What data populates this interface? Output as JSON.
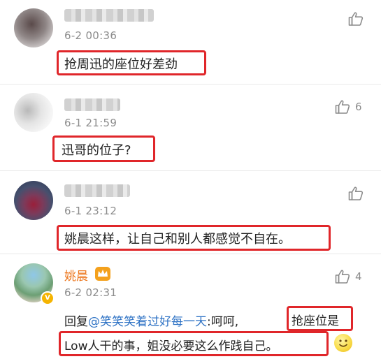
{
  "comments": [
    {
      "time": "6-2 00:36",
      "text": "抢周迅的座位好差劲",
      "likes": ""
    },
    {
      "time": "6-1 21:59",
      "text": "迅哥的位子?",
      "likes": "6"
    },
    {
      "time": "6-1 23:12",
      "text": "姚晨这样，让自己和别人都感觉不自在。",
      "likes": ""
    },
    {
      "name": "姚晨",
      "time": "6-2 02:31",
      "likes": "4",
      "reply_prefix": "回复",
      "mention": "@笑笑笑着过好每一天",
      "reply_mid": ":呵呵,",
      "reply_highlight_1": "抢座位是",
      "reply_line2": "Low人干的事，姐没必要这么作践自己。"
    }
  ],
  "icons": {
    "like": "thumbs-up-icon",
    "vip_crown": "crown-icon",
    "verified": "verified-v-icon",
    "emoji": "smile-emoji-icon"
  },
  "colors": {
    "highlight_border": "#e0262a",
    "username_vip": "#ec7419",
    "mention": "#2f73c5",
    "meta_gray": "#8c8c8c"
  }
}
